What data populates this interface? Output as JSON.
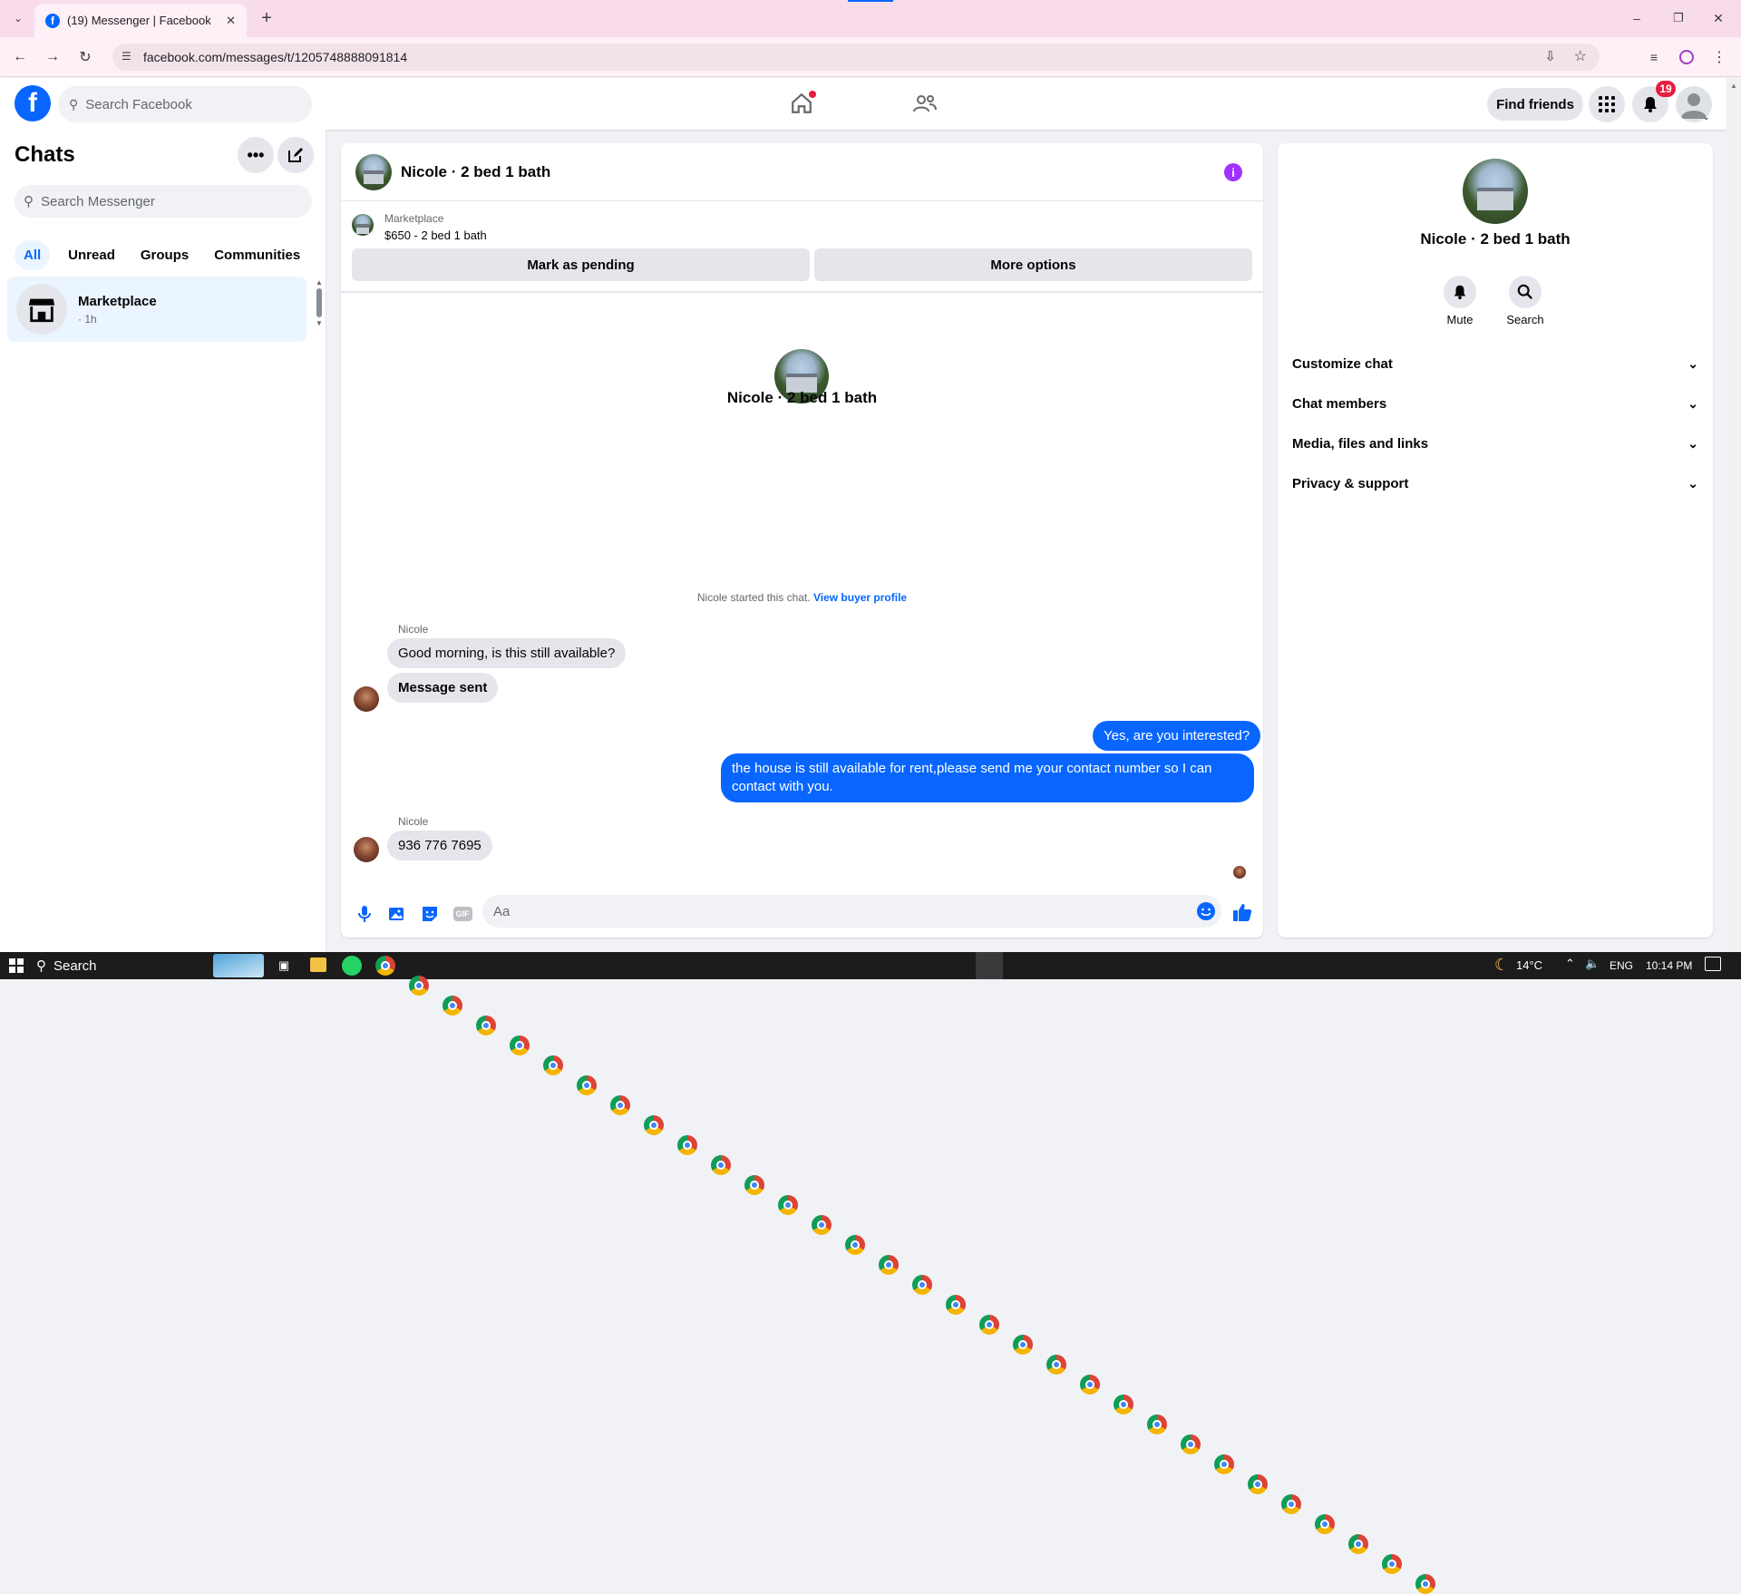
{
  "browser": {
    "tab_title": "(19) Messenger | Facebook",
    "new_tab": "+",
    "url": "facebook.com/messages/t/1205748888091814",
    "window_min": "–",
    "window_max": "❐",
    "window_close": "✕"
  },
  "fbnav": {
    "search_placeholder": "Search Facebook",
    "find_friends": "Find friends",
    "notification_count": "19"
  },
  "chats": {
    "title": "Chats",
    "search_placeholder": "Search Messenger",
    "filters": [
      "All",
      "Unread",
      "Groups",
      "Communities"
    ],
    "items": [
      {
        "name": "Marketplace",
        "time": "· 1h"
      }
    ]
  },
  "conversation": {
    "title": "Nicole · 2 bed 1 bath",
    "listing_source": "Marketplace",
    "listing_desc": "$650 - 2 bed 1 bath",
    "mark_pending": "Mark as pending",
    "more_options": "More options",
    "profile_name": "Nicole · 2 bed 1 bath",
    "started_text": "Nicole started this chat.",
    "view_buyer": "View buyer profile",
    "sender1": "Nicole",
    "msg1": "Good morning, is this still available?",
    "msg2": "Message sent",
    "out1": "Yes, are you interested?",
    "out2": "the house is still available for rent,please send me your contact number so I can contact with you.",
    "sender2": "Nicole",
    "msg3": "936 776 7695",
    "composer_placeholder": "Aa"
  },
  "details": {
    "name": "Nicole · 2 bed 1 bath",
    "mute": "Mute",
    "search": "Search",
    "sections": [
      "Customize chat",
      "Chat members",
      "Media, files and links",
      "Privacy & support"
    ]
  },
  "taskbar": {
    "search": "Search",
    "temp": "14°C",
    "lang": "ENG",
    "time": "10:14 PM"
  },
  "colors": {
    "accent": "#0866ff",
    "fb_blue": "#0866ff",
    "badge": "#e41e3f",
    "info_purple": "#a033ff"
  }
}
